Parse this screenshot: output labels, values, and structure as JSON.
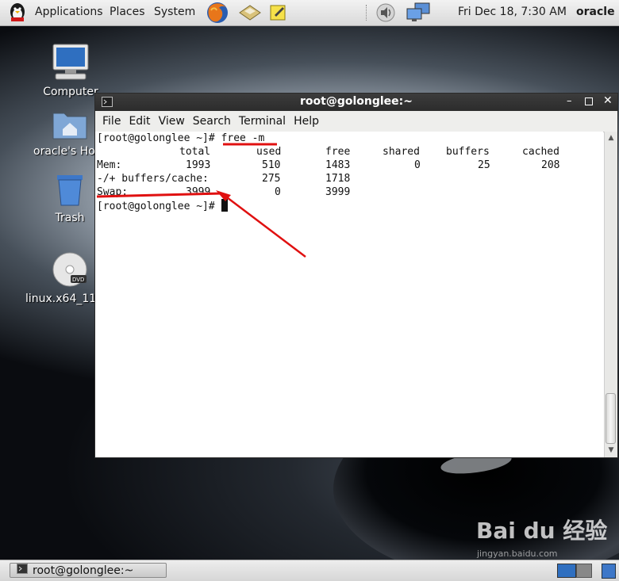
{
  "top_panel": {
    "menus": [
      "Applications",
      "Places",
      "System"
    ],
    "clock": "Fri Dec 18,  7:30 AM",
    "user": "oracle"
  },
  "desktop_icons": {
    "computer": "Computer",
    "home": "oracle's Hor",
    "trash": "Trash",
    "dvd": "linux.x64_11g"
  },
  "terminal": {
    "title": "root@golonglee:~",
    "menus": [
      "File",
      "Edit",
      "View",
      "Search",
      "Terminal",
      "Help"
    ],
    "prompt": "[root@golonglee ~]# ",
    "command": "free -m",
    "columns": [
      "total",
      "used",
      "free",
      "shared",
      "buffers",
      "cached"
    ],
    "rows": [
      {
        "label": "Mem:",
        "values": [
          "1993",
          "510",
          "1483",
          "0",
          "25",
          "208"
        ]
      },
      {
        "label": "-/+ buffers/cache:",
        "values": [
          "",
          "275",
          "1718",
          "",
          "",
          ""
        ]
      },
      {
        "label": "Swap:",
        "values": [
          "3999",
          "0",
          "3999",
          "",
          "",
          ""
        ]
      }
    ],
    "prompt2": "[root@golonglee ~]# "
  },
  "bottom_panel": {
    "task": "root@golonglee:~"
  },
  "watermark": {
    "brand": "Bai du 经验",
    "url": "jingyan.baidu.com"
  },
  "colors": {
    "annotation": "#e01010",
    "title_bar": "#333333"
  }
}
